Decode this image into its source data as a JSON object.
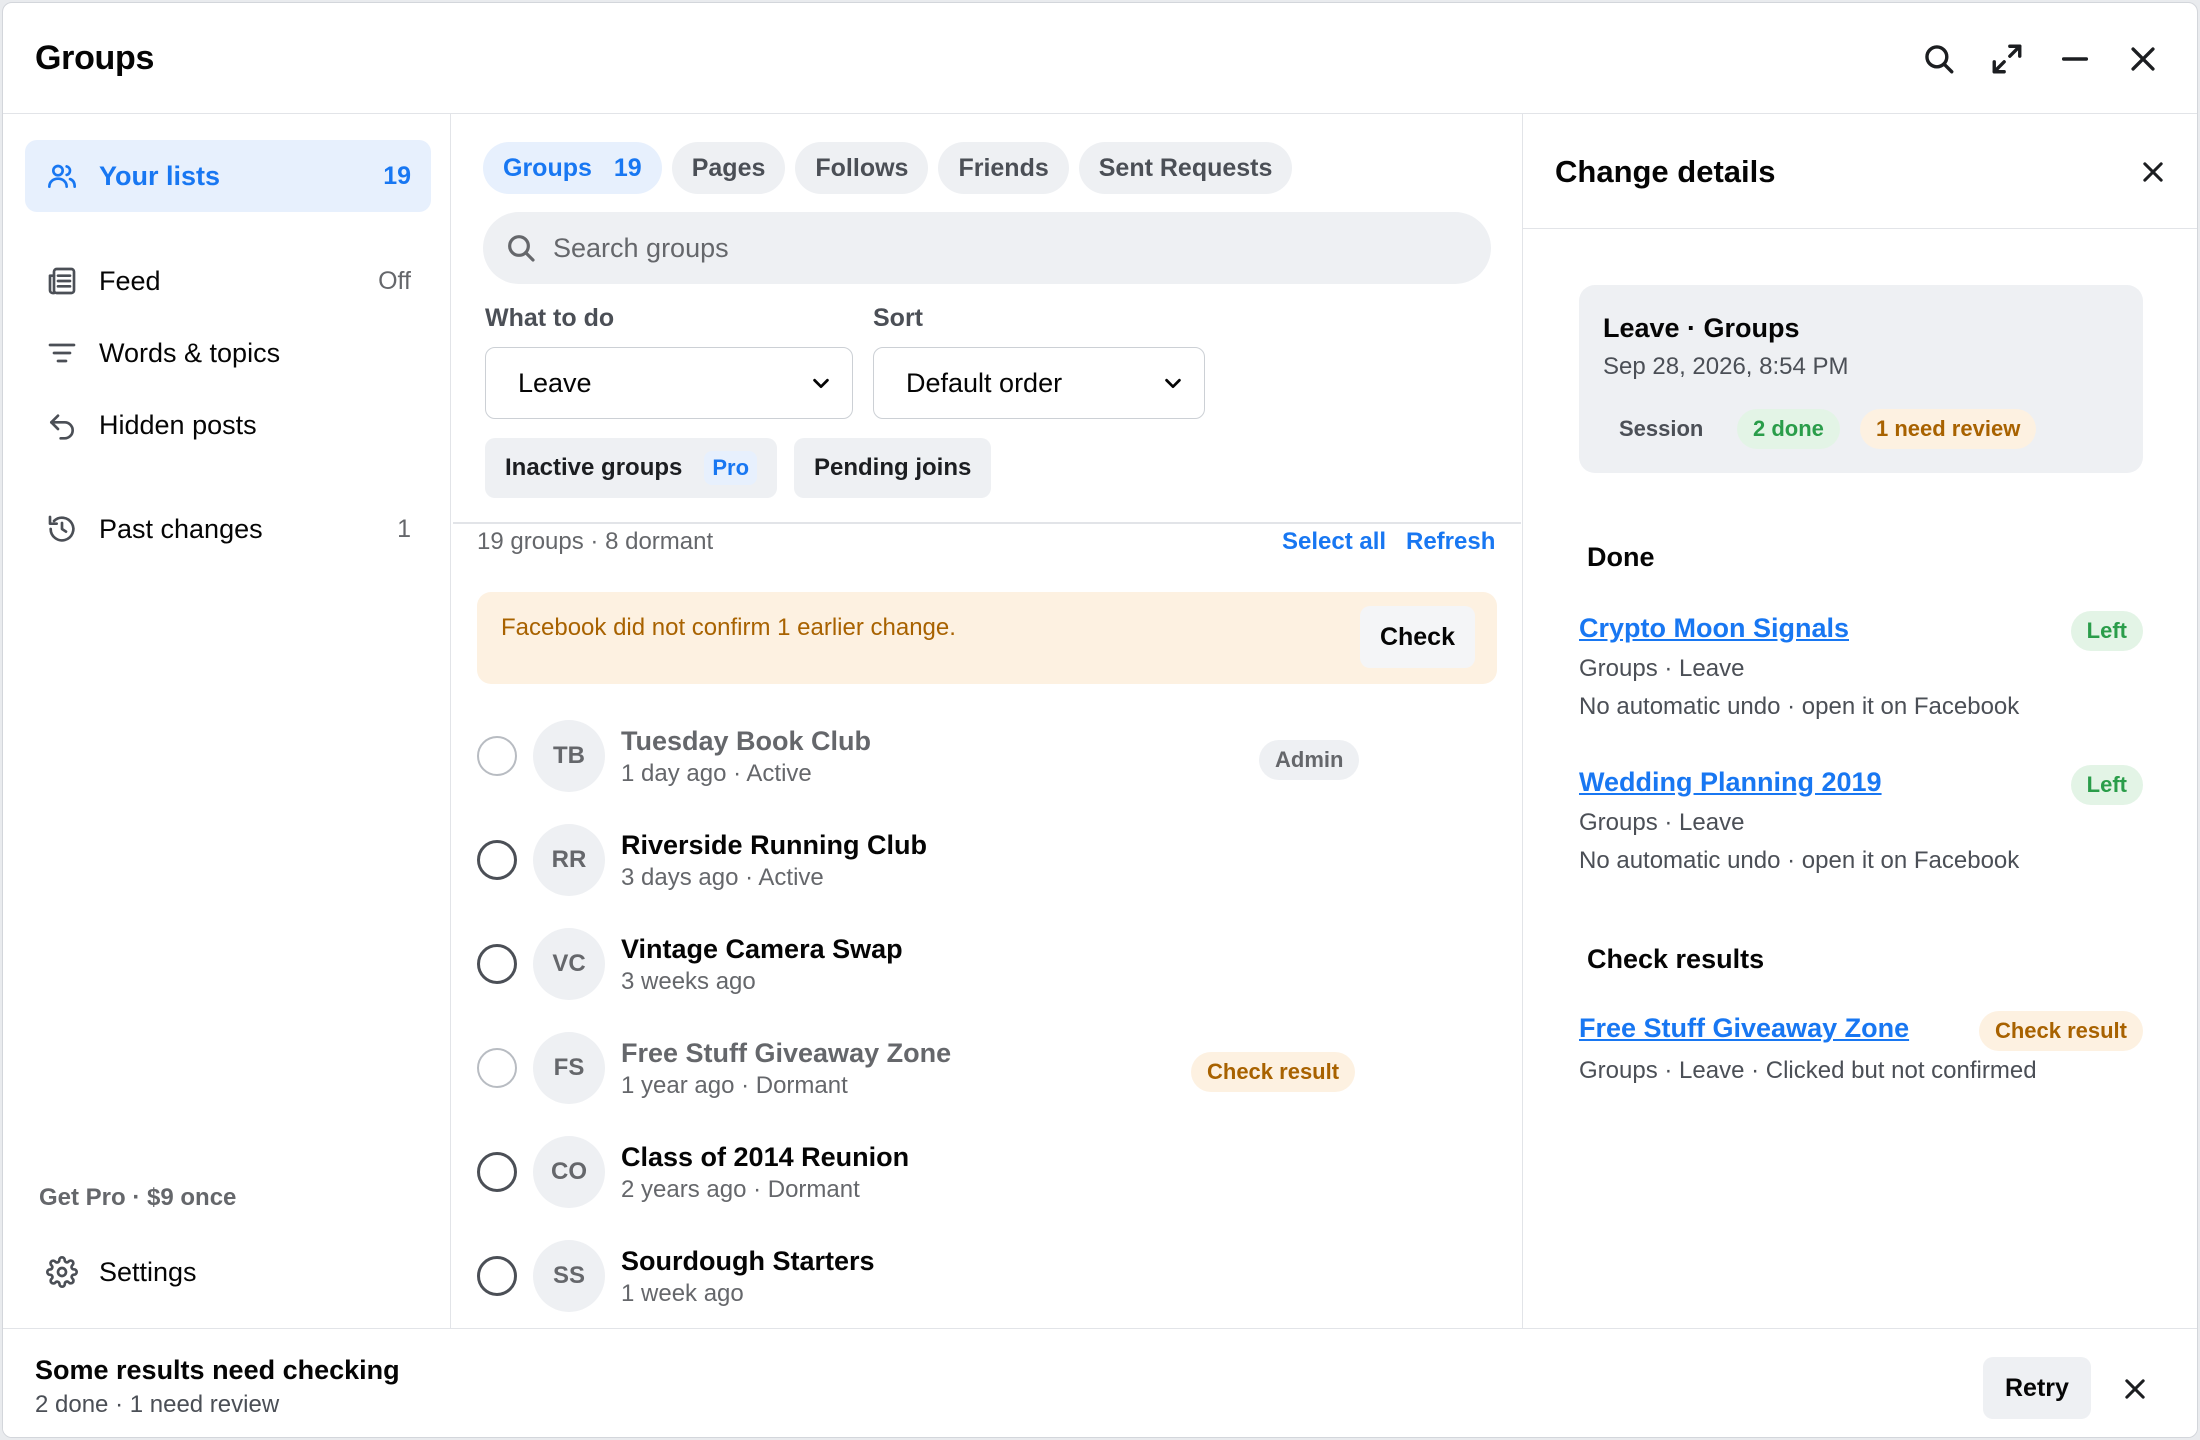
{
  "window": {
    "title": "Groups"
  },
  "sidebar": {
    "items": [
      {
        "label": "Your lists",
        "count": "19"
      },
      {
        "label": "Feed",
        "count": "Off"
      },
      {
        "label": "Words & topics",
        "count": ""
      },
      {
        "label": "Hidden posts",
        "count": ""
      },
      {
        "label": "Past changes",
        "count": "1"
      }
    ],
    "get_pro": "Get Pro · $9 once",
    "settings": "Settings"
  },
  "tabs": [
    {
      "label": "Groups",
      "count": "19"
    },
    {
      "label": "Pages"
    },
    {
      "label": "Follows"
    },
    {
      "label": "Friends"
    },
    {
      "label": "Sent Requests"
    }
  ],
  "search": {
    "placeholder": "Search groups",
    "value": ""
  },
  "filters": {
    "action_label": "What to do",
    "action_value": "Leave",
    "sort_label": "Sort",
    "sort_value": "Default order",
    "chips": [
      {
        "label": "Inactive groups",
        "badge": "Pro"
      },
      {
        "label": "Pending joins"
      }
    ]
  },
  "list": {
    "summary": "19 groups · 8 dormant",
    "select_all": "Select all",
    "refresh": "Refresh",
    "warning": "Facebook did not confirm 1 earlier change.",
    "warning_action": "Check",
    "rows": [
      {
        "initials": "TB",
        "name": "Tuesday Book Club",
        "meta": "1 day ago · Active",
        "tag": "Admin"
      },
      {
        "initials": "RR",
        "name": "Riverside Running Club",
        "meta": "3 days ago · Active",
        "tag": ""
      },
      {
        "initials": "VC",
        "name": "Vintage Camera Swap",
        "meta": "3 weeks ago",
        "tag": ""
      },
      {
        "initials": "FS",
        "name": "Free Stuff Giveaway Zone",
        "meta": "1 year ago · Dormant",
        "tag": "Check result"
      },
      {
        "initials": "CO",
        "name": "Class of 2014 Reunion",
        "meta": "2 years ago · Dormant",
        "tag": ""
      },
      {
        "initials": "SS",
        "name": "Sourdough Starters",
        "meta": "1 week ago",
        "tag": ""
      }
    ]
  },
  "details": {
    "title": "Change details",
    "session": {
      "title": "Leave · Groups",
      "date": "Sep 28, 2026, 8:54 PM",
      "label": "Session",
      "done": "2 done",
      "review": "1 need review"
    },
    "done_heading": "Done",
    "done": [
      {
        "name": "Crypto Moon Signals",
        "line1": "Groups · Leave",
        "line2": "No automatic undo · open it on Facebook",
        "status": "Left"
      },
      {
        "name": "Wedding Planning 2019",
        "line1": "Groups · Leave",
        "line2": "No automatic undo · open it on Facebook",
        "status": "Left"
      }
    ],
    "check_heading": "Check results",
    "check": [
      {
        "name": "Free Stuff Giveaway Zone",
        "line1": "Groups · Leave · Clicked but not confirmed",
        "status": "Check result"
      }
    ]
  },
  "toast": {
    "title": "Some results need checking",
    "subtitle": "2 done · 1 need review",
    "retry": "Retry"
  },
  "colors": {
    "accent": "#1877f2",
    "success": "#2a9d4a",
    "warning": "#a86200",
    "warning_bg": "#fdf1e1"
  }
}
